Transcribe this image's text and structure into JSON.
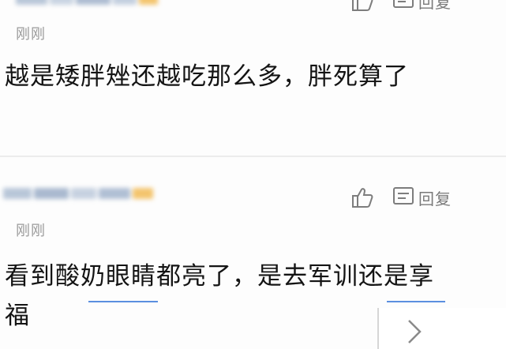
{
  "comments": [
    {
      "time": "刚刚",
      "text": "越是矮胖矬还越吃那么多，胖死算了",
      "reply_label": "回复"
    },
    {
      "time": "刚刚",
      "text": "看到酸奶眼睛都亮了，是去军训还是享福",
      "reply_label": "回复"
    }
  ],
  "icons": {
    "like": "thumbs-up-icon",
    "comment": "comment-icon",
    "next": "chevron-right-icon"
  },
  "colors": {
    "text": "#141414",
    "meta": "#9a9a9a",
    "icon": "#7d7d7d",
    "divider": "#ececec",
    "accent": "#5b8fe0"
  }
}
